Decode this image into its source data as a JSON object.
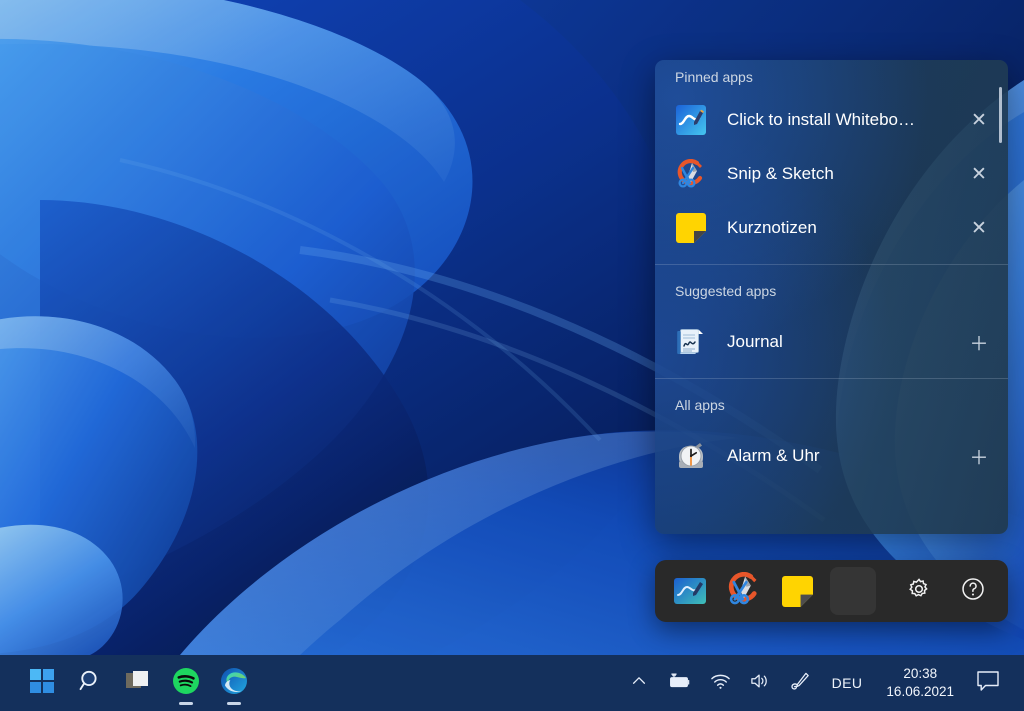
{
  "desktop": {
    "wallpaper_name": "windows-11-bloom-wallpaper",
    "colors": {
      "deep_blue": "#071f5c",
      "mid_blue": "#1a57c8",
      "light_blue": "#4d9bf5",
      "accent_blue": "#2f6fe0"
    }
  },
  "pen_flyout": {
    "name": "pen-menu-flyout",
    "sections": [
      {
        "id": "pinned",
        "header": "Pinned apps",
        "items": [
          {
            "label": "Click to install Whitebo…",
            "icon": "whiteboard-icon",
            "action": "close-icon",
            "action_glyph": "✕"
          },
          {
            "label": "Snip & Sketch",
            "icon": "snip-and-sketch-icon",
            "action": "close-icon",
            "action_glyph": "✕"
          },
          {
            "label": "Kurznotizen",
            "icon": "sticky-notes-icon",
            "action": "close-icon",
            "action_glyph": "✕"
          }
        ]
      },
      {
        "id": "suggested",
        "header": "Suggested apps",
        "items": [
          {
            "label": "Journal",
            "icon": "journal-icon",
            "action": "add-icon",
            "action_glyph": "＋"
          }
        ]
      },
      {
        "id": "all",
        "header": "All apps",
        "items": [
          {
            "label": "Alarm & Uhr",
            "icon": "alarm-clock-icon",
            "action": "add-icon",
            "action_glyph": "＋"
          }
        ]
      }
    ],
    "scrollbar": {
      "name": "vertical-scrollbar",
      "position": "top"
    }
  },
  "pen_toolbar": {
    "name": "pen-toolbar",
    "buttons": [
      {
        "id": "whiteboard",
        "icon": "whiteboard-icon",
        "label": "Whiteboard"
      },
      {
        "id": "snip",
        "icon": "snip-and-sketch-icon",
        "label": "Snip & Sketch"
      },
      {
        "id": "sticky",
        "icon": "sticky-notes-icon",
        "label": "Kurznotizen"
      },
      {
        "id": "blank",
        "icon": "blank-tile-icon",
        "label": ""
      },
      {
        "id": "settings",
        "icon": "gear-icon",
        "label": "Settings"
      },
      {
        "id": "help",
        "icon": "help-circle-icon",
        "label": "Help"
      }
    ]
  },
  "taskbar": {
    "name": "taskbar",
    "apps": [
      {
        "id": "start",
        "icon": "windows-start-icon",
        "label": "Start",
        "running": false
      },
      {
        "id": "search",
        "icon": "search-icon",
        "label": "Search",
        "running": false
      },
      {
        "id": "taskview",
        "icon": "task-view-icon",
        "label": "Task View",
        "running": false
      },
      {
        "id": "spotify",
        "icon": "spotify-icon",
        "label": "Spotify",
        "running": true
      },
      {
        "id": "edge",
        "icon": "microsoft-edge-icon",
        "label": "Microsoft Edge",
        "running": true
      }
    ],
    "tray": {
      "overflow": {
        "icon": "chevron-up-icon",
        "label": "Show hidden icons"
      },
      "battery": {
        "icon": "battery-charging-icon",
        "label": "Battery charging"
      },
      "network": {
        "icon": "wifi-icon",
        "label": "Network"
      },
      "volume": {
        "icon": "speaker-icon",
        "label": "Volume"
      },
      "pen": {
        "icon": "pen-menu-icon",
        "label": "Pen menu"
      },
      "language": "DEU",
      "clock": {
        "time": "20:38",
        "date": "16.06.2021"
      },
      "notifications": {
        "icon": "chat-bubble-icon",
        "label": "Notifications"
      }
    }
  }
}
